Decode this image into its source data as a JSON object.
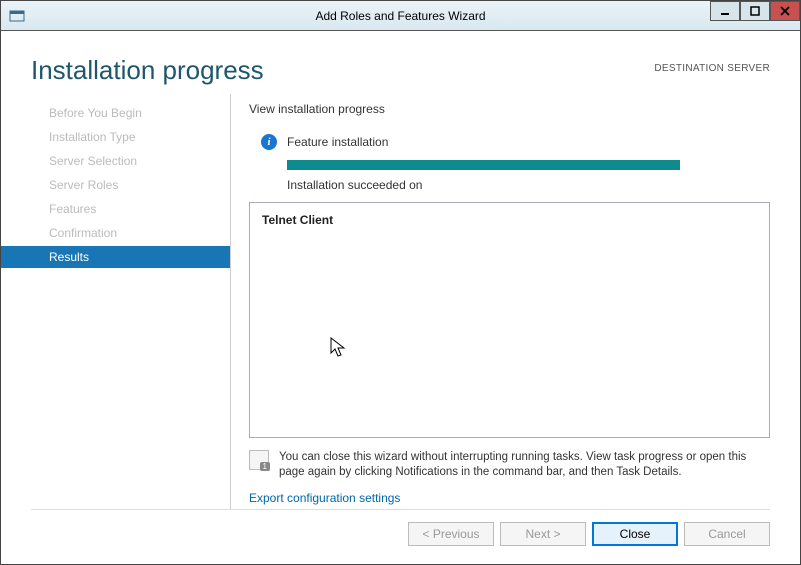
{
  "window": {
    "title": "Add Roles and Features Wizard"
  },
  "header": {
    "page_title": "Installation progress",
    "destination_label": "DESTINATION SERVER"
  },
  "sidebar": {
    "items": [
      {
        "label": "Before You Begin",
        "active": false
      },
      {
        "label": "Installation Type",
        "active": false
      },
      {
        "label": "Server Selection",
        "active": false
      },
      {
        "label": "Server Roles",
        "active": false
      },
      {
        "label": "Features",
        "active": false
      },
      {
        "label": "Confirmation",
        "active": false
      },
      {
        "label": "Results",
        "active": true
      }
    ]
  },
  "main": {
    "view_label": "View installation progress",
    "status_heading": "Feature installation",
    "succeeded_text": "Installation succeeded on",
    "result_item": "Telnet Client",
    "note_text": "You can close this wizard without interrupting running tasks. View task progress or open this page again by clicking Notifications in the command bar, and then Task Details.",
    "export_link": "Export configuration settings"
  },
  "buttons": {
    "previous": "< Previous",
    "next": "Next >",
    "close": "Close",
    "cancel": "Cancel"
  }
}
